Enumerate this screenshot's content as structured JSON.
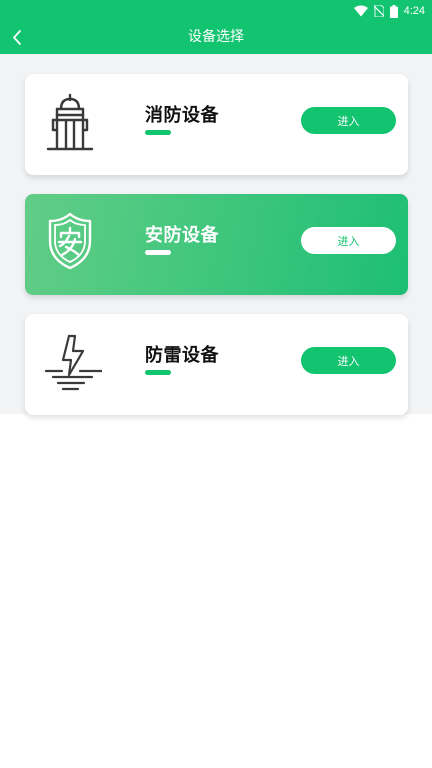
{
  "status_bar": {
    "time": "4:24",
    "icons": [
      "wifi-icon",
      "no-sim-icon",
      "battery-icon"
    ]
  },
  "header": {
    "title": "设备选择",
    "back_icon": "chevron-left-icon"
  },
  "colors": {
    "accent": "#12c470",
    "active_card_gradient": [
      "#62cd86",
      "#1dbf74"
    ],
    "background": "#f2f3f5"
  },
  "devices": [
    {
      "name": "消防设备",
      "button_label": "进入",
      "icon": "fire-hydrant-icon",
      "selected": false
    },
    {
      "name": "安防设备",
      "button_label": "进入",
      "icon": "security-shield-icon",
      "selected": true
    },
    {
      "name": "防雷设备",
      "button_label": "进入",
      "icon": "lightning-ground-icon",
      "selected": false
    }
  ]
}
